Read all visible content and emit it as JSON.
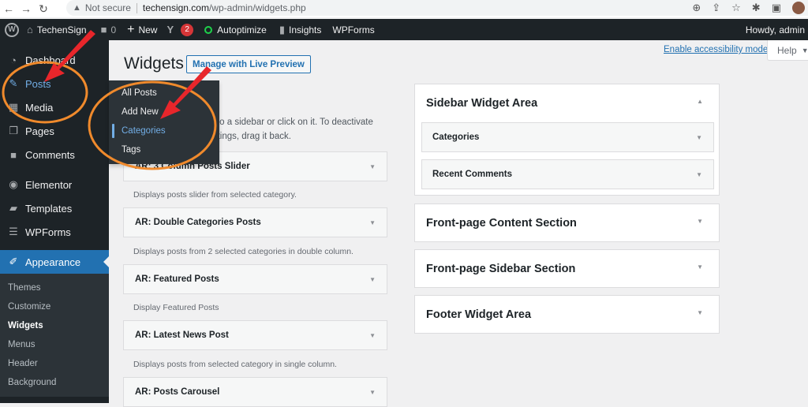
{
  "browser": {
    "security_label": "Not secure",
    "url_host": "techensign.com",
    "url_path": "/wp-admin/widgets.php"
  },
  "adminbar": {
    "site_name": "TechenSign",
    "comments_count": "0",
    "new_label": "New",
    "yoast_badge": "2",
    "autoptimize_label": "Autoptimize",
    "insights_label": "Insights",
    "wpforms_label": "WPForms",
    "howdy": "Howdy, admin"
  },
  "sidebar": {
    "items": [
      {
        "label": "Dashboard",
        "icon": "dashboard-icon"
      },
      {
        "label": "Posts",
        "icon": "pin-icon"
      },
      {
        "label": "Media",
        "icon": "media-icon"
      },
      {
        "label": "Pages",
        "icon": "pages-icon"
      },
      {
        "label": "Comments",
        "icon": "comment-icon"
      },
      {
        "label": "Elementor",
        "icon": "elementor-icon"
      },
      {
        "label": "Templates",
        "icon": "folder-icon"
      },
      {
        "label": "WPForms",
        "icon": "form-icon"
      },
      {
        "label": "Appearance",
        "icon": "brush-icon"
      }
    ],
    "appearance_submenu": [
      "Themes",
      "Customize",
      "Widgets",
      "Menus",
      "Header",
      "Background"
    ],
    "posts_flyout": [
      "All Posts",
      "Add New",
      "Categories",
      "Tags"
    ]
  },
  "main": {
    "title": "Widgets",
    "live_preview_button": "Manage with Live Preview",
    "accessibility_link": "Enable accessibility mode",
    "help_label": "Help",
    "intro_line1": "it to a sidebar or click on it. To deactivate",
    "intro_line2": "ettings, drag it back.",
    "available_widgets": [
      {
        "title": "AR: 3 Column Posts Slider",
        "desc": "Displays posts slider from selected category."
      },
      {
        "title": "AR: Double Categories Posts",
        "desc": "Displays posts from 2 selected categories in double column."
      },
      {
        "title": "AR: Featured Posts",
        "desc": "Display Featured Posts"
      },
      {
        "title": "AR: Latest News Post",
        "desc": "Displays posts from selected category in single column."
      },
      {
        "title": "AR: Posts Carousel",
        "desc": ""
      }
    ],
    "widget_areas": [
      {
        "title": "Sidebar Widget Area",
        "expanded": true,
        "widgets": [
          "Categories",
          "Recent Comments"
        ]
      },
      {
        "title": "Front-page Content Section",
        "expanded": false,
        "widgets": []
      },
      {
        "title": "Front-page Sidebar Section",
        "expanded": false,
        "widgets": []
      },
      {
        "title": "Footer Widget Area",
        "expanded": false,
        "widgets": []
      }
    ]
  },
  "colors": {
    "admin_bar": "#1d2327",
    "accent": "#2271b1",
    "highlight": "#72aee6",
    "annotation_arrow": "#e8262b",
    "annotation_ellipse": "#f08a2c"
  }
}
